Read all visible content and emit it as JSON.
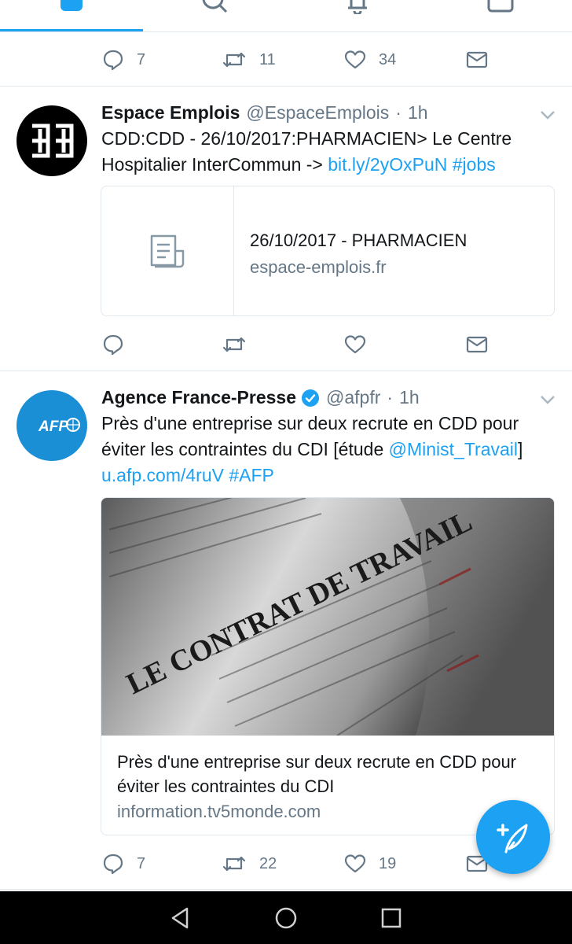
{
  "tweets": [
    {
      "actions": {
        "reply": "7",
        "retweet": "11",
        "like": "34"
      }
    },
    {
      "name": "Espace Emplois",
      "handle": "@EspaceEmplois",
      "dot": "·",
      "time": "1h",
      "text_prefix": "CDD:CDD - 26/10/2017:PHARMACIEN> Le Centre Hospitalier InterCommun -> ",
      "link1": "bit.ly/2yOxPuN",
      "link2": "#jobs",
      "card": {
        "title": "26/10/2017 - PHARMACIEN",
        "domain": "espace-emplois.fr"
      },
      "actions": {
        "reply": "",
        "retweet": "",
        "like": ""
      }
    },
    {
      "name": "Agence France-Presse",
      "handle": "@afpfr",
      "dot": "·",
      "time": "1h",
      "text_prefix": "Près d'une entreprise sur deux recrute en CDD pour éviter les contraintes du CDI [étude ",
      "mention": "@Minist_Travail",
      "text_bracket": "]",
      "link1": "u.afp.com/4ruV",
      "link2": "#AFP",
      "avatar_text": "AFP",
      "card": {
        "image_words": [
          "LE CONTRAT DE TRAVAIL"
        ],
        "title": "Près d'une entreprise sur deux recrute en CDD pour éviter les contraintes du CDI",
        "domain": "information.tv5monde.com"
      },
      "actions": {
        "reply": "7",
        "retweet": "22",
        "like": "19"
      }
    }
  ],
  "icons": {
    "reply": "reply-icon",
    "retweet": "retweet-icon",
    "like": "heart-icon",
    "dm": "mail-icon",
    "compose": "compose-icon"
  },
  "colors": {
    "accent": "#1da1f2",
    "muted": "#657786",
    "afp_blue": "#1a8fd6"
  }
}
